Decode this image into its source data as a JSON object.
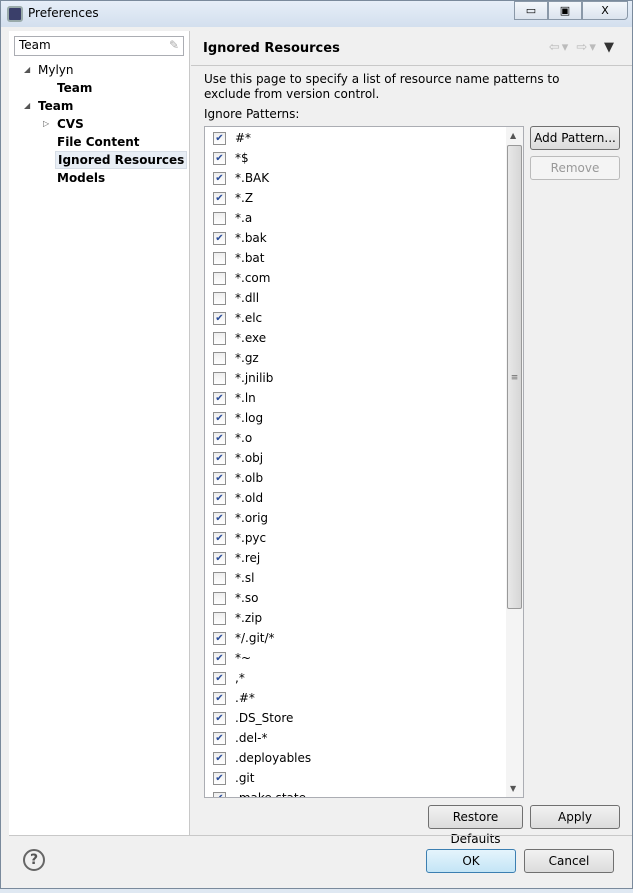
{
  "window": {
    "title": "Preferences",
    "minimize": "▭",
    "maximize": "▣",
    "close": "X"
  },
  "filter": {
    "value": "Team",
    "clear_icon": "eraser-icon"
  },
  "tree": [
    {
      "label": "Mylyn",
      "twisty": "◢",
      "level": 0,
      "bold": false
    },
    {
      "label": "Team",
      "level": 1,
      "bold": true
    },
    {
      "label": "Team",
      "twisty": "◢",
      "level": 0,
      "bold": true
    },
    {
      "label": "CVS",
      "twisty": "▷",
      "level": 1,
      "bold": true
    },
    {
      "label": "File Content",
      "level": 1,
      "bold": true
    },
    {
      "label": "Ignored Resources",
      "level": 1,
      "bold": true,
      "selected": true
    },
    {
      "label": "Models",
      "level": 1,
      "bold": true
    }
  ],
  "page": {
    "title": "Ignored Resources",
    "nav": {
      "back": "⇦",
      "back_dd": "▾",
      "forward": "⇨",
      "forward_dd": "▾",
      "menu": "▼"
    },
    "description": "Use this page to specify a list of resource name patterns to exclude from version control.",
    "patterns_label": "Ignore Patterns:",
    "patterns": [
      {
        "name": "#*",
        "checked": true
      },
      {
        "name": "*$",
        "checked": true
      },
      {
        "name": "*.BAK",
        "checked": true
      },
      {
        "name": "*.Z",
        "checked": true
      },
      {
        "name": "*.a",
        "checked": false
      },
      {
        "name": "*.bak",
        "checked": true
      },
      {
        "name": "*.bat",
        "checked": false
      },
      {
        "name": "*.com",
        "checked": false
      },
      {
        "name": "*.dll",
        "checked": false
      },
      {
        "name": "*.elc",
        "checked": true
      },
      {
        "name": "*.exe",
        "checked": false
      },
      {
        "name": "*.gz",
        "checked": false
      },
      {
        "name": "*.jnilib",
        "checked": false
      },
      {
        "name": "*.ln",
        "checked": true
      },
      {
        "name": "*.log",
        "checked": true
      },
      {
        "name": "*.o",
        "checked": true
      },
      {
        "name": "*.obj",
        "checked": true
      },
      {
        "name": "*.olb",
        "checked": true
      },
      {
        "name": "*.old",
        "checked": true
      },
      {
        "name": "*.orig",
        "checked": true
      },
      {
        "name": "*.pyc",
        "checked": true
      },
      {
        "name": "*.rej",
        "checked": true
      },
      {
        "name": "*.sl",
        "checked": false
      },
      {
        "name": "*.so",
        "checked": false
      },
      {
        "name": "*.zip",
        "checked": false
      },
      {
        "name": "*/.git/*",
        "checked": true
      },
      {
        "name": "*~",
        "checked": true
      },
      {
        "name": ",*",
        "checked": true
      },
      {
        "name": ".#*",
        "checked": true
      },
      {
        "name": ".DS_Store",
        "checked": true
      },
      {
        "name": ".del-*",
        "checked": true
      },
      {
        "name": ".deployables",
        "checked": true
      },
      {
        "name": ".git",
        "checked": true
      },
      {
        "name": ".make.state",
        "checked": true
      }
    ],
    "add_pattern": "Add Pattern...",
    "remove": "Remove",
    "restore_defaults": "Restore Defaults",
    "apply": "Apply"
  },
  "footer": {
    "help": "?",
    "ok": "OK",
    "cancel": "Cancel"
  }
}
